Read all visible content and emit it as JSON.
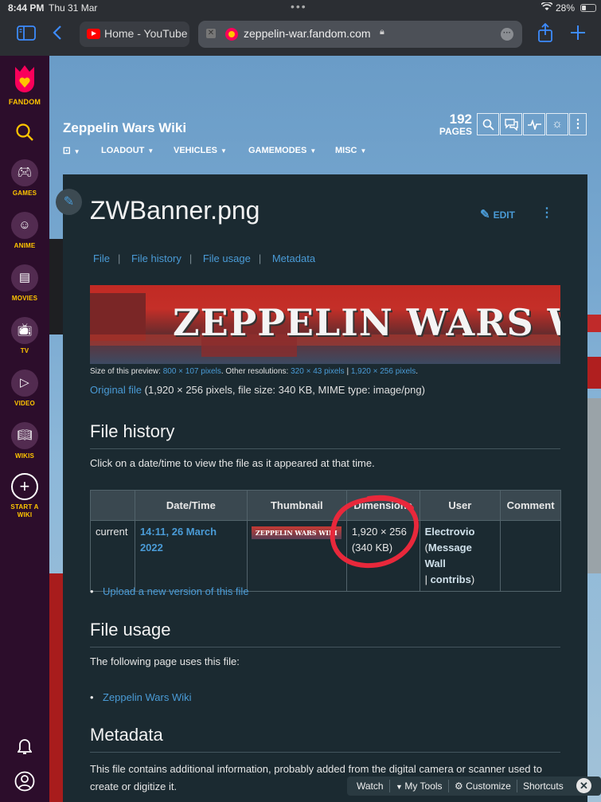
{
  "status_bar": {
    "time": "8:44 PM",
    "date": "Thu 31 Mar",
    "battery_percent": "28%"
  },
  "browser": {
    "tabs": [
      {
        "label": "Home - YouTube",
        "favicon": "youtube-icon"
      },
      {
        "label": "zeppelin-war.fandom.com",
        "favicon": "fandom-icon",
        "active": true
      }
    ],
    "icons": [
      "sidebar-icon",
      "back-icon",
      "share-icon",
      "new-tab-icon"
    ],
    "accent_color": "#3d8bfd"
  },
  "fandom_rail": {
    "logo_label": "FANDOM",
    "items": [
      {
        "label": "GAMES",
        "icon": "gamepad-icon"
      },
      {
        "label": "ANIME",
        "icon": "anime-face-icon"
      },
      {
        "label": "MOVIES",
        "icon": "clapperboard-icon"
      },
      {
        "label": "TV",
        "icon": "tv-icon"
      },
      {
        "label": "VIDEO",
        "icon": "play-icon"
      },
      {
        "label": "WIKIS",
        "icon": "book-icon"
      },
      {
        "label": "START A WIKI",
        "icon": "plus-icon"
      }
    ],
    "accent_color": "#ffc500",
    "background_color": "#2c0d2b"
  },
  "wiki_header": {
    "title": "Zeppelin Wars Wiki",
    "page_count": "192",
    "page_count_label": "PAGES",
    "nav": [
      {
        "label": "LOADOUT"
      },
      {
        "label": "VEHICLES"
      },
      {
        "label": "GAMEMODES"
      },
      {
        "label": "MISC"
      }
    ]
  },
  "page": {
    "title": "ZWBanner.png",
    "edit_label": "EDIT",
    "toc": [
      "File",
      "File history",
      "File usage",
      "Metadata"
    ],
    "banner_text": "ZEPPELIN WARS WI",
    "preview": {
      "prefix": "Size of this preview: ",
      "preview_size": "800 × 107 pixels",
      "middle": ". Other resolutions: ",
      "res1": "320 × 43 pixels",
      "res2": "1,920 × 256 pixels",
      "suffix": "."
    },
    "original": {
      "link": "Original file",
      "details": " (1,920 × 256 pixels, file size: 340 KB, MIME type: image/png)"
    },
    "file_history": {
      "heading": "File history",
      "intro": "Click on a date/time to view the file as it appeared at that time.",
      "columns": [
        "",
        "Date/Time",
        "Thumbnail",
        "Dimensions",
        "User",
        "Comment"
      ],
      "rows": [
        {
          "status": "current",
          "datetime": "14:11, 26 March 2022",
          "thumbnail_text": "ZEPPELIN WARS WIKI",
          "dimensions": "1,920 × 256",
          "size": "(340 KB)",
          "user": "Electrovio",
          "user_links": [
            "Message Wall",
            "contribs"
          ],
          "comment": ""
        }
      ],
      "upload_link": "Upload a new version of this file"
    },
    "file_usage": {
      "heading": "File usage",
      "intro": "The following page uses this file:",
      "pages": [
        "Zeppelin Wars Wiki"
      ]
    },
    "metadata": {
      "heading": "Metadata",
      "intro": "This file contains additional information, probably added from the digital camera or scanner used to create or digitize it."
    }
  },
  "toolbar": {
    "watch": "Watch",
    "my_tools": "My Tools",
    "customize": "Customize",
    "shortcuts": "Shortcuts"
  },
  "annotation": {
    "type": "red-circle",
    "color": "#e8283b"
  },
  "link_color": "#4a9bd6"
}
